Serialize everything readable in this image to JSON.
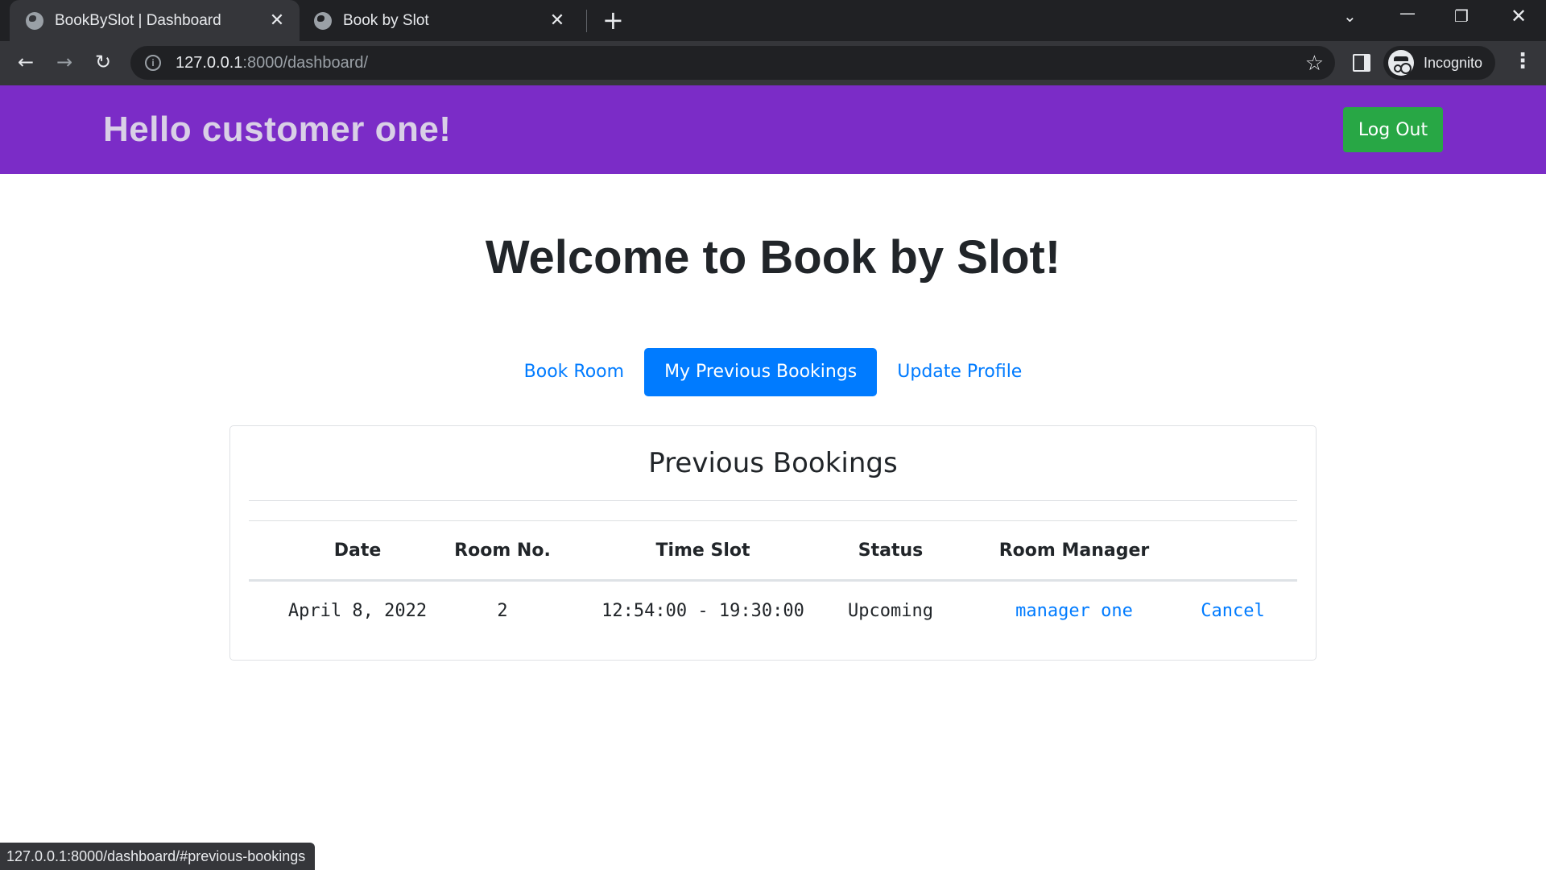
{
  "browser": {
    "tabs": [
      {
        "title": "BookBySlot | Dashboard",
        "active": true
      },
      {
        "title": "Book by Slot",
        "active": false
      }
    ],
    "url_host": "127.0.0.1",
    "url_rest": ":8000/dashboard/",
    "profile_label": "Incognito",
    "status_url": "127.0.0.1:8000/dashboard/#previous-bookings"
  },
  "header": {
    "greeting": "Hello customer one!",
    "logout_label": "Log Out",
    "bg_color": "#7b2cc7",
    "logout_color": "#28a745"
  },
  "main": {
    "title": "Welcome to Book by Slot!",
    "tabs": [
      {
        "label": "Book Room",
        "active": false
      },
      {
        "label": "My Previous Bookings",
        "active": true
      },
      {
        "label": "Update Profile",
        "active": false
      }
    ],
    "accent_color": "#007bff"
  },
  "bookings": {
    "title": "Previous Bookings",
    "columns": [
      "Date",
      "Room No.",
      "Time Slot",
      "Status",
      "Room Manager"
    ],
    "rows": [
      {
        "date": "April 8, 2022",
        "room": "2",
        "time_slot": "12:54:00 - 19:30:00",
        "status": "Upcoming",
        "manager": "manager one",
        "action": "Cancel"
      }
    ]
  }
}
